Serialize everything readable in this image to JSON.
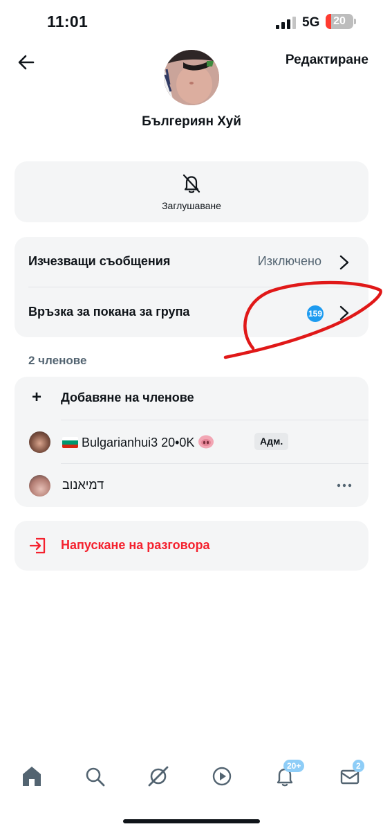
{
  "status_bar": {
    "time": "11:01",
    "network": "5G",
    "battery": "20",
    "battery_level": 0.2
  },
  "header": {
    "edit_label": "Редактиране",
    "group_name": "Бългериян Хуй"
  },
  "mute": {
    "label": "Заглушаване",
    "icon": "bell-off-icon"
  },
  "settings": {
    "disappearing_label": "Изчезващи съобщения",
    "disappearing_value": "Изключено",
    "invite_label": "Връзка за покана за група",
    "invite_badge": "159"
  },
  "members": {
    "count_label": "2 членове",
    "add_label": "Добавяне на членове",
    "list": [
      {
        "name": "Bulgarianhui3 20•0K",
        "flag": "bulgaria-flag",
        "emoji": "pig-nose",
        "badge": "Адм."
      },
      {
        "name": "דמיאנוב"
      }
    ]
  },
  "leave": {
    "label": "Напускане на разговора"
  },
  "tabs": {
    "items": [
      "home-icon",
      "search-icon",
      "grok-icon",
      "video-icon",
      "notifications-icon",
      "messages-icon"
    ],
    "notifications_badge": "20+",
    "messages_badge": "2"
  },
  "colors": {
    "accent": "#1d9bf0",
    "danger": "#f4212e",
    "card_bg": "#f4f5f6",
    "scribble": "#e01818"
  }
}
